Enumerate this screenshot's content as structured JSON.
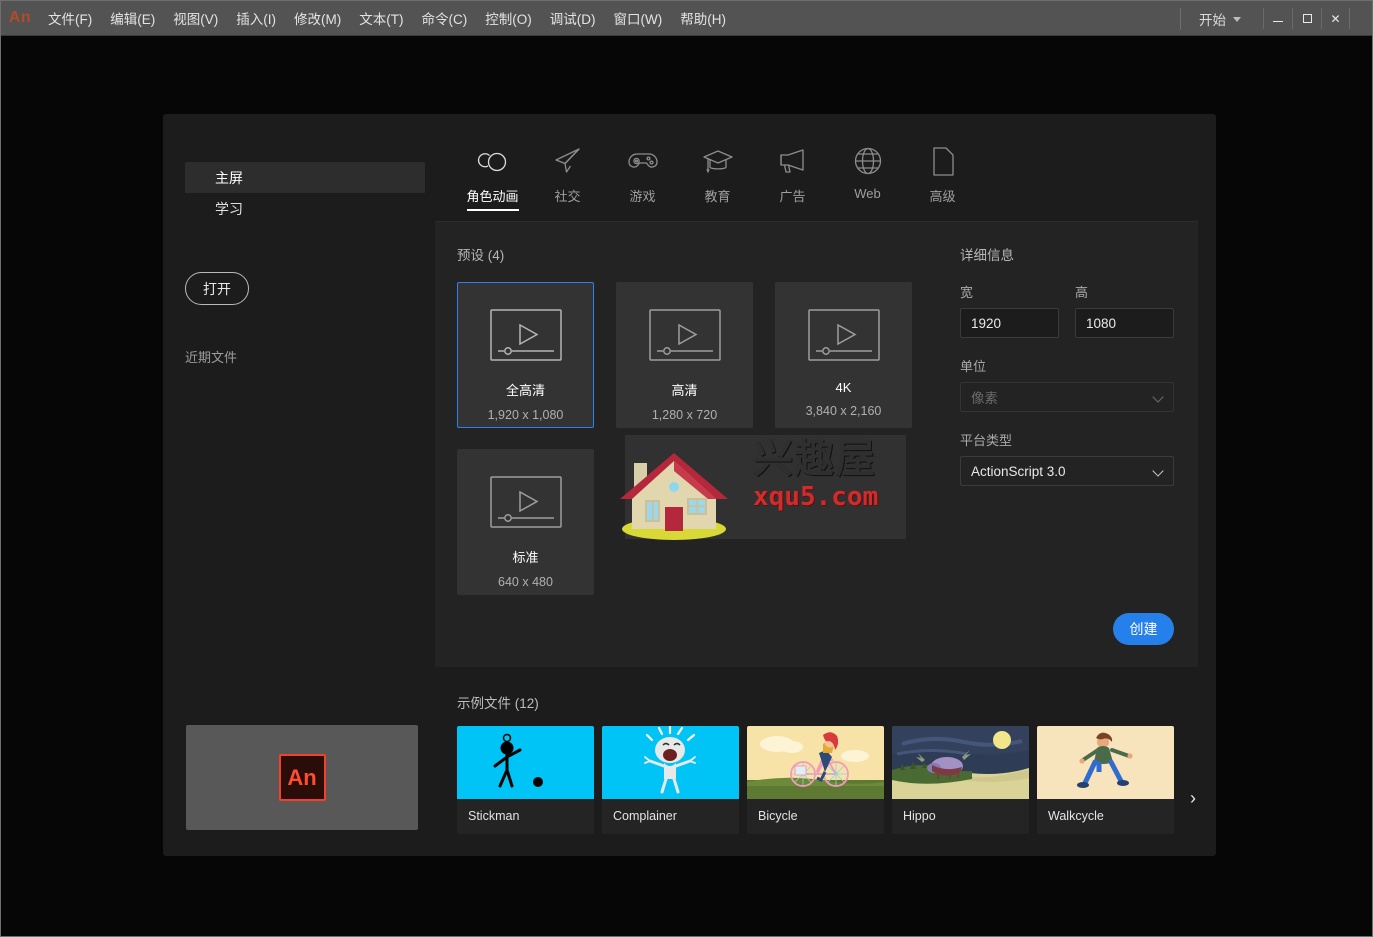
{
  "window": {
    "app_logo": "An",
    "menu_items": [
      "文件(F)",
      "编辑(E)",
      "视图(V)",
      "插入(I)",
      "修改(M)",
      "文本(T)",
      "命令(C)",
      "控制(O)",
      "调试(D)",
      "窗口(W)",
      "帮助(H)"
    ],
    "workspace_label": "开始",
    "minimize_tooltip": "最小化",
    "maximize_tooltip": "最大化",
    "close_glyph": "✕"
  },
  "sidebar": {
    "items": [
      {
        "label": "主屏",
        "active": true
      },
      {
        "label": "学习",
        "active": false
      }
    ],
    "open_button": "打开",
    "recent_label": "近期文件",
    "recent_thumb_icon": "An"
  },
  "tabs": [
    {
      "label": "角色动画",
      "icon": "character-animation-icon",
      "active": true
    },
    {
      "label": "社交",
      "icon": "paper-plane-icon",
      "active": false
    },
    {
      "label": "游戏",
      "icon": "gamepad-icon",
      "active": false
    },
    {
      "label": "教育",
      "icon": "graduation-cap-icon",
      "active": false
    },
    {
      "label": "广告",
      "icon": "megaphone-icon",
      "active": false
    },
    {
      "label": "Web",
      "icon": "globe-icon",
      "active": false
    },
    {
      "label": "高级",
      "icon": "document-icon",
      "active": false
    }
  ],
  "presets": {
    "title": "预设 (4)",
    "count": 4,
    "items": [
      {
        "name": "全高清",
        "dimensions": "1,920 x 1,080",
        "selected": true
      },
      {
        "name": "高清",
        "dimensions": "1,280 x 720",
        "selected": false
      },
      {
        "name": "4K",
        "dimensions": "3,840 x 2,160",
        "selected": false
      },
      {
        "name": "标准",
        "dimensions": "640 x 480",
        "selected": false
      }
    ]
  },
  "details": {
    "title": "详细信息",
    "width_label": "宽",
    "width_value": "1920",
    "height_label": "高",
    "height_value": "1080",
    "units_label": "单位",
    "units_value": "像素",
    "platform_label": "平台类型",
    "platform_value": "ActionScript 3.0",
    "create_button": "创建"
  },
  "samples": {
    "title": "示例文件 (12)",
    "count": 12,
    "items": [
      {
        "name": "Stickman",
        "thumb": "stickman-thumb"
      },
      {
        "name": "Complainer",
        "thumb": "complainer-thumb"
      },
      {
        "name": "Bicycle",
        "thumb": "bicycle-thumb"
      },
      {
        "name": "Hippo",
        "thumb": "hippo-thumb"
      },
      {
        "name": "Walkcycle",
        "thumb": "walkcycle-thumb"
      }
    ],
    "next_arrow": "›"
  },
  "watermark": {
    "cn_text": "兴趣屋",
    "url_text": "xqu5.com"
  },
  "colors": {
    "accent_blue": "#2680eb",
    "selection_border": "#2f80e8",
    "panel_bg": "#232323",
    "card_bg": "#333333",
    "window_bg": "#1c1c1c",
    "an_red": "#ff4d31"
  }
}
